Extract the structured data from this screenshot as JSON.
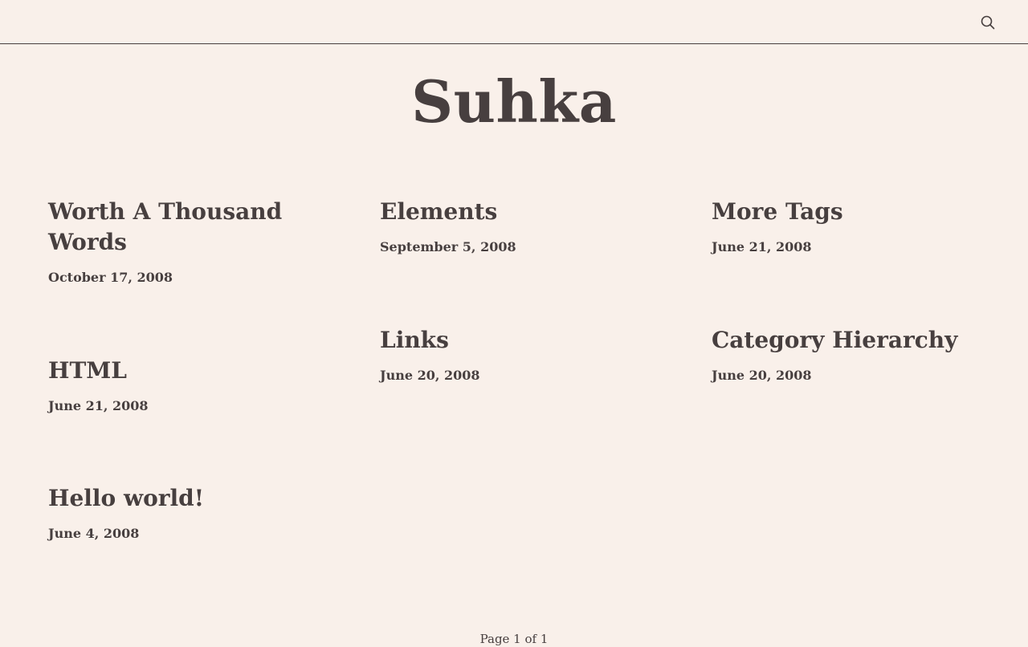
{
  "header": {
    "search_icon": "search-icon"
  },
  "site": {
    "title": "Suhka"
  },
  "posts": [
    {
      "title": "Worth A Thousand Words",
      "date": "October 17, 2008"
    },
    {
      "title": "Elements",
      "date": "September 5, 2008"
    },
    {
      "title": "More Tags",
      "date": "June 21, 2008"
    },
    {
      "title": "HTML",
      "date": "June 21, 2008"
    },
    {
      "title": "Links",
      "date": "June 20, 2008"
    },
    {
      "title": "Category Hierarchy",
      "date": "June 20, 2008"
    },
    {
      "title": "Hello world!",
      "date": "June 4, 2008"
    }
  ],
  "pagination": {
    "label": "Page 1 of 1"
  }
}
